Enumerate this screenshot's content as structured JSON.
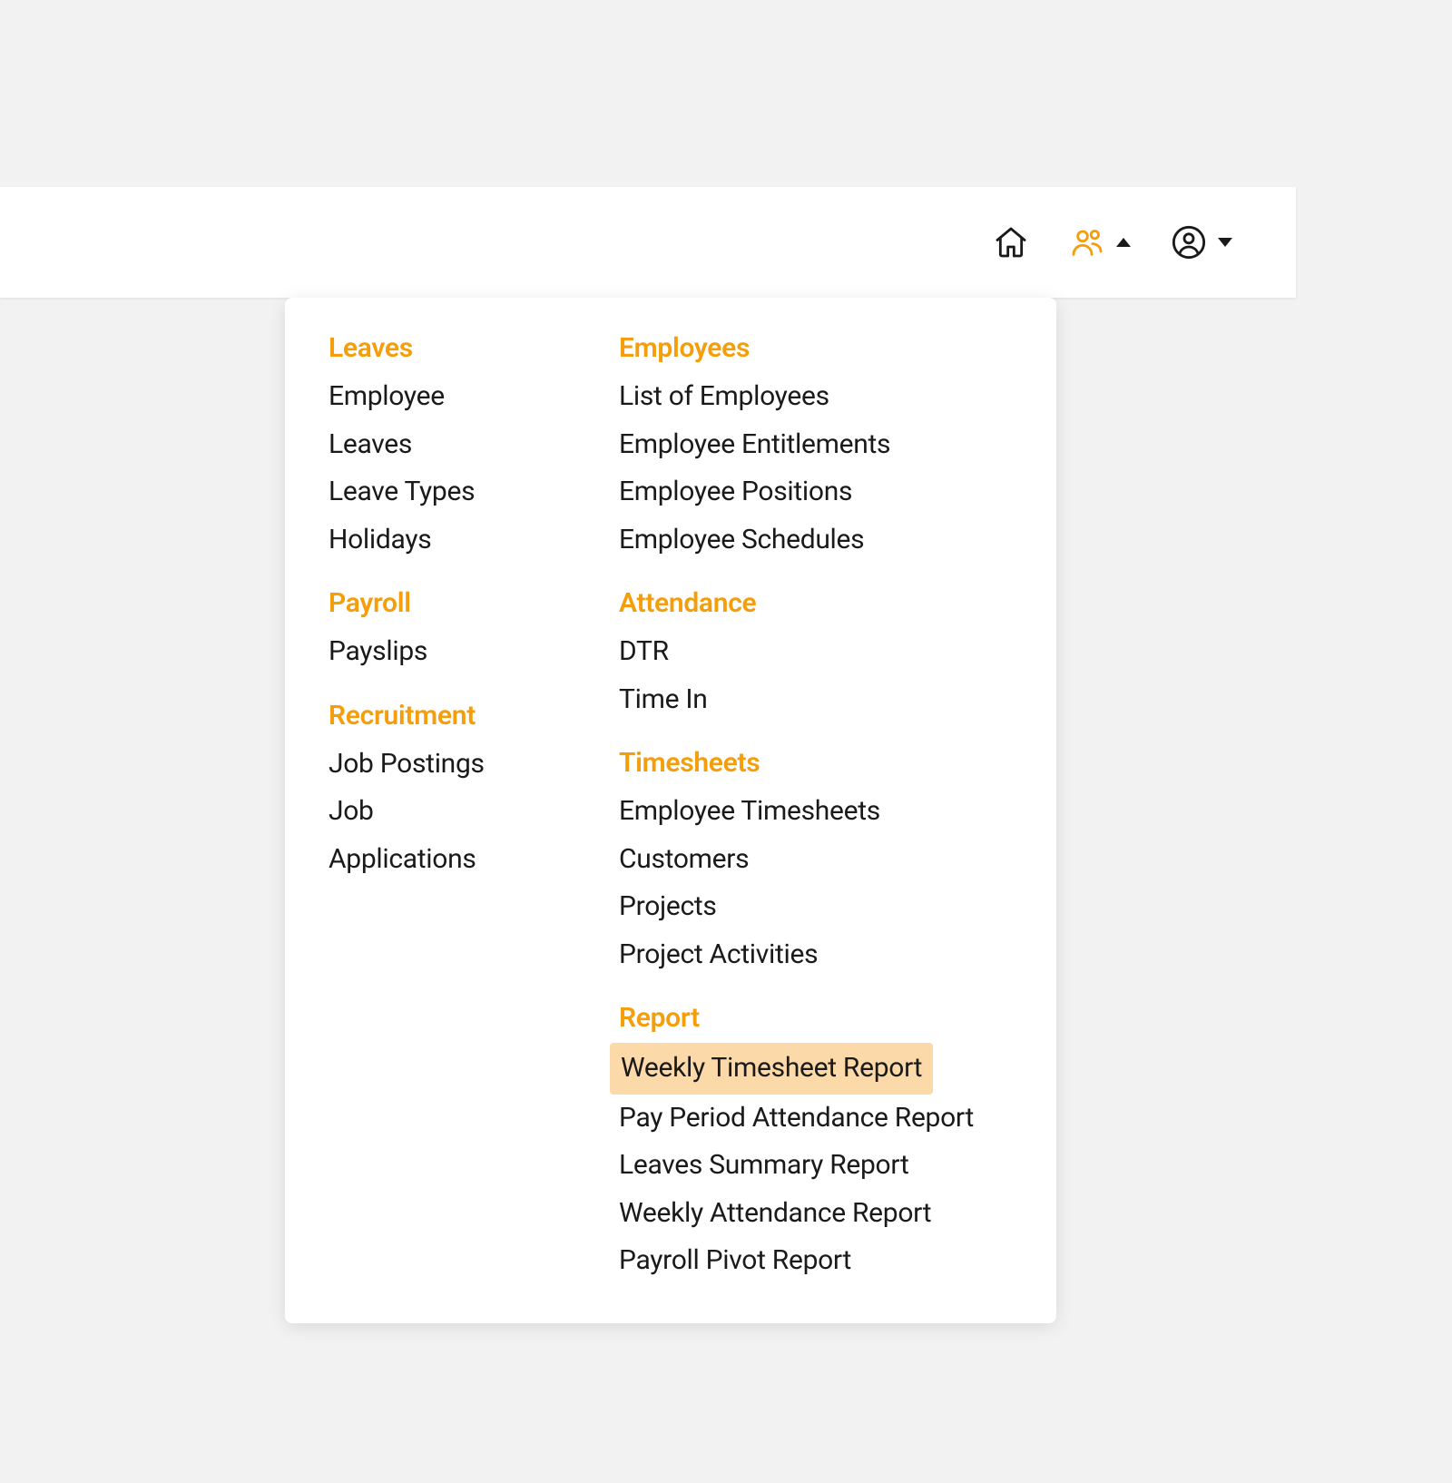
{
  "colors": {
    "accent": "#f59e0b",
    "highlight": "#fcd9a9",
    "text": "#1a1a1a",
    "background": "#f2f2f2"
  },
  "topbar": {
    "home_icon": "home-icon",
    "people_icon": "people-icon",
    "profile_icon": "profile-icon"
  },
  "menu": {
    "column1": [
      {
        "header": "Leaves",
        "items": [
          {
            "label": "Employee Leaves",
            "highlighted": false
          },
          {
            "label": "Leave Types",
            "highlighted": false
          },
          {
            "label": "Holidays",
            "highlighted": false
          }
        ]
      },
      {
        "header": "Payroll",
        "items": [
          {
            "label": "Payslips",
            "highlighted": false
          }
        ]
      },
      {
        "header": "Recruitment",
        "items": [
          {
            "label": "Job Postings",
            "highlighted": false
          },
          {
            "label": "Job Applications",
            "highlighted": false
          }
        ]
      }
    ],
    "column2": [
      {
        "header": "Employees",
        "items": [
          {
            "label": "List of Employees",
            "highlighted": false
          },
          {
            "label": "Employee Entitlements",
            "highlighted": false
          },
          {
            "label": "Employee Positions",
            "highlighted": false
          },
          {
            "label": "Employee Schedules",
            "highlighted": false
          }
        ]
      },
      {
        "header": "Attendance",
        "items": [
          {
            "label": "DTR",
            "highlighted": false
          },
          {
            "label": "Time In",
            "highlighted": false
          }
        ]
      },
      {
        "header": "Timesheets",
        "items": [
          {
            "label": "Employee Timesheets",
            "highlighted": false
          },
          {
            "label": "Customers",
            "highlighted": false
          },
          {
            "label": "Projects",
            "highlighted": false
          },
          {
            "label": "Project Activities",
            "highlighted": false
          }
        ]
      },
      {
        "header": "Report",
        "items": [
          {
            "label": "Weekly Timesheet Report",
            "highlighted": true
          },
          {
            "label": "Pay Period Attendance Report",
            "highlighted": false
          },
          {
            "label": "Leaves Summary Report",
            "highlighted": false
          },
          {
            "label": "Weekly Attendance Report",
            "highlighted": false
          },
          {
            "label": "Payroll Pivot Report",
            "highlighted": false
          }
        ]
      }
    ]
  }
}
